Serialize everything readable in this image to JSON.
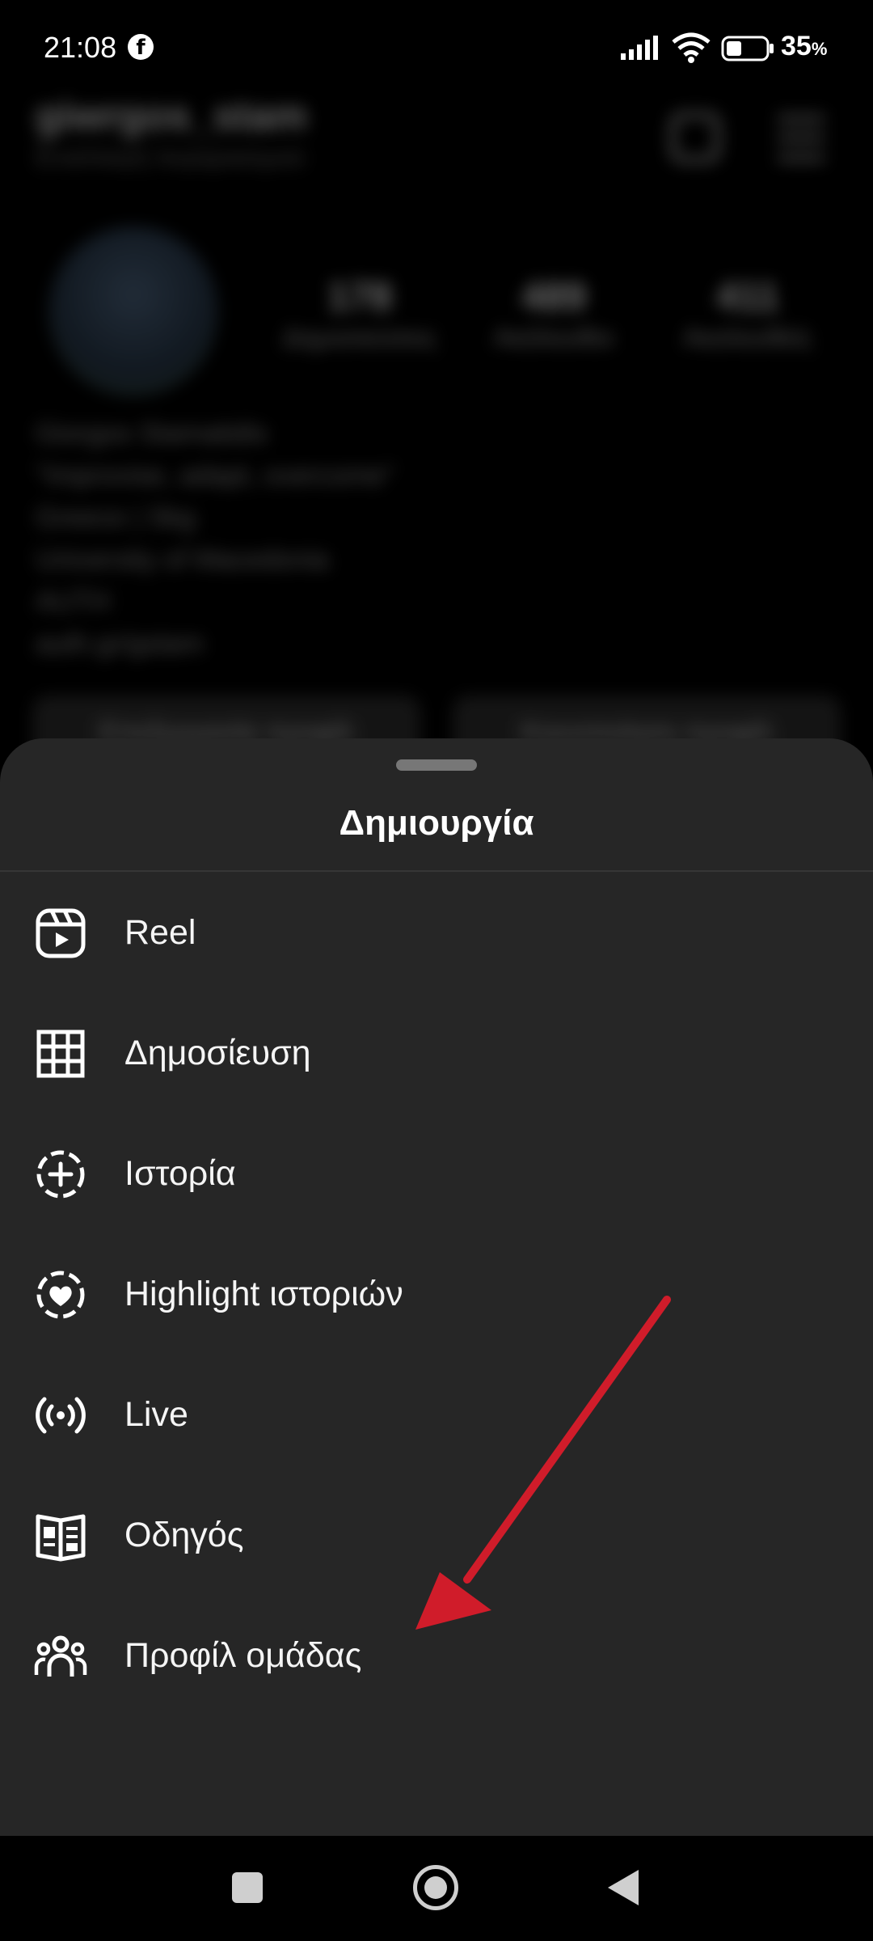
{
  "status_bar": {
    "time": "21:08",
    "notification_icon": "facebook-icon",
    "battery_value": "35",
    "battery_unit": "%"
  },
  "profile_background": {
    "username": "giwrgos_stam",
    "switch_label": "Εναλλαγή λογαριασμού",
    "stats": [
      {
        "number": "178",
        "label": "Δημοσιεύσεις"
      },
      {
        "number": "489",
        "label": "Ακόλουθοι"
      },
      {
        "number": "411",
        "label": "Ακολουθείς"
      }
    ],
    "bio_lines": [
      "Giorgos Stamatidis",
      "\"Improvise, adapt, overcome\"",
      "Greece | Skg",
      "University of Macedonia",
      "AUTH",
      "auth.gr/gstam"
    ],
    "buttons": [
      "Επεξεργασία προφίλ",
      "Κοινοποίηση προφίλ"
    ]
  },
  "sheet": {
    "title": "Δημιουργία",
    "items": [
      {
        "label": "Reel",
        "icon": "reel-icon"
      },
      {
        "label": "Δημοσίευση",
        "icon": "grid-post-icon"
      },
      {
        "label": "Ιστορία",
        "icon": "story-add-icon"
      },
      {
        "label": "Highlight ιστοριών",
        "icon": "story-highlight-heart-icon"
      },
      {
        "label": "Live",
        "icon": "live-broadcast-icon"
      },
      {
        "label": "Οδηγός",
        "icon": "guide-book-icon"
      },
      {
        "label": "Προφίλ ομάδας",
        "icon": "group-profile-icon"
      }
    ]
  },
  "annotation": {
    "arrow_color": "#d01c2a",
    "points_to": "Προφίλ ομάδας"
  },
  "colors": {
    "sheet_bg": "#262626",
    "background": "#000000",
    "text": "#ffffff"
  }
}
